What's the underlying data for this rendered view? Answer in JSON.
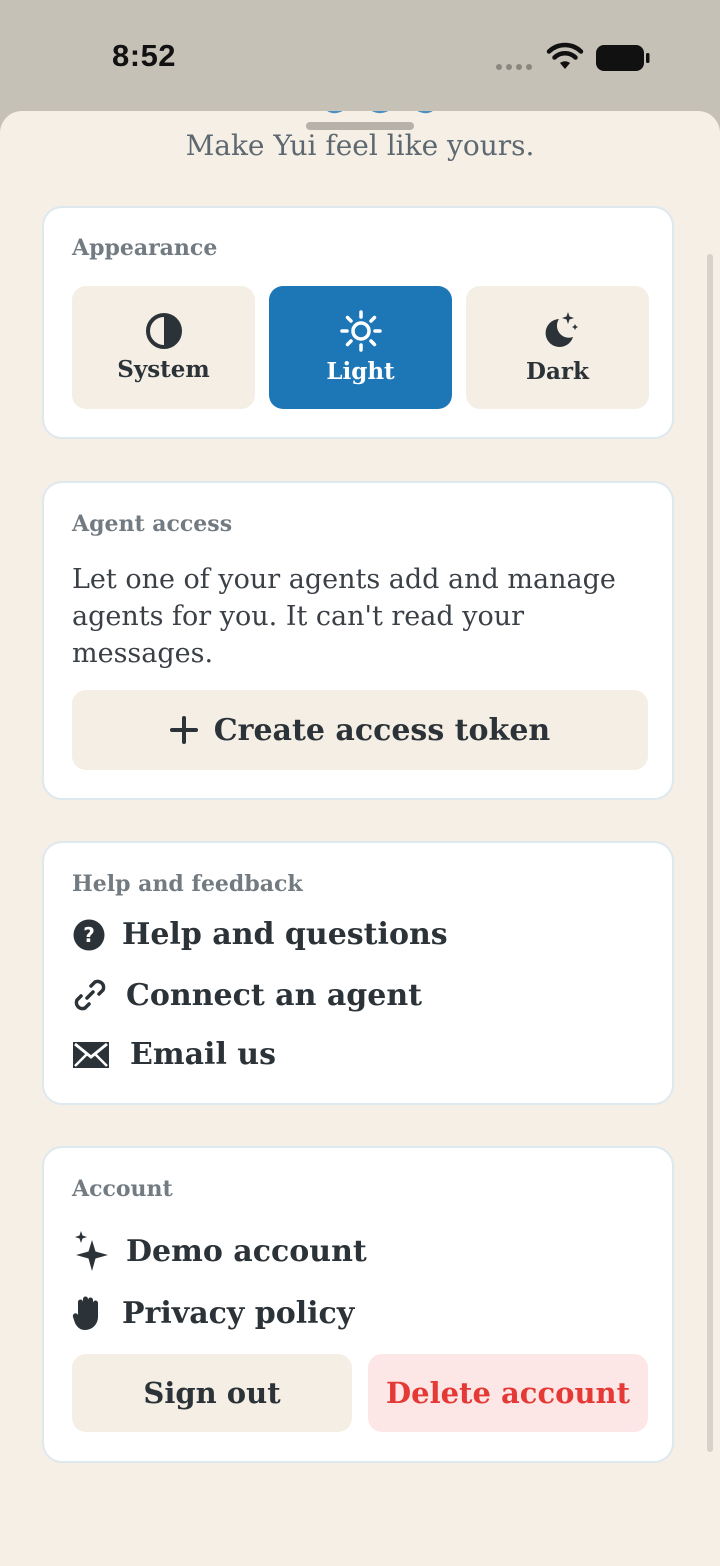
{
  "status": {
    "time": "8:52"
  },
  "header": {
    "subtitle": "Make Yui feel like yours."
  },
  "appearance": {
    "title": "Appearance",
    "options": [
      {
        "label": "System",
        "icon": "half-circle-icon",
        "selected": false
      },
      {
        "label": "Light",
        "icon": "sun-icon",
        "selected": true
      },
      {
        "label": "Dark",
        "icon": "moon-stars-icon",
        "selected": false
      }
    ]
  },
  "agent_access": {
    "title": "Agent access",
    "description": "Let one of your agents add and manage agents for you. It can't read your messages.",
    "button_label": "Create access token",
    "button_icon": "plus-icon"
  },
  "help": {
    "title": "Help and feedback",
    "items": [
      {
        "label": "Help and questions",
        "icon": "question-circle-icon"
      },
      {
        "label": "Connect an agent",
        "icon": "link-icon"
      },
      {
        "label": "Email us",
        "icon": "envelope-icon"
      }
    ]
  },
  "account": {
    "title": "Account",
    "items": [
      {
        "label": "Demo account",
        "icon": "sparkles-icon"
      },
      {
        "label": "Privacy policy",
        "icon": "hand-icon"
      }
    ],
    "sign_out_label": "Sign out",
    "delete_label": "Delete account"
  },
  "colors": {
    "accent": "#1d76b6",
    "background": "#f6efe6",
    "danger": "#e53935",
    "danger_bg": "#fde7e6"
  }
}
